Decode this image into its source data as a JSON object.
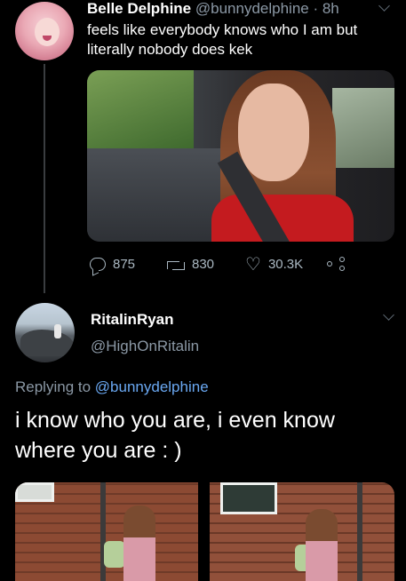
{
  "tweet1": {
    "name": "Belle Delphine",
    "handle_time": "@bunnydelphine · 8h",
    "text": "feels like everybody knows who I am but literally nobody does kek",
    "stats": {
      "replies": "875",
      "retweets": "830",
      "likes": "30.3K"
    },
    "icons": [
      "reply-icon",
      "retweet-icon",
      "like-icon",
      "share-icon",
      "chevron-down-icon"
    ]
  },
  "tweet2": {
    "name": "RitalinRyan",
    "handle": "@HighOnRitalin",
    "replying_prefix": "Replying to",
    "replying_mention": "@bunnydelphine",
    "text": "i know who you are, i even know where you are : )"
  },
  "colors": {
    "background": "#000000",
    "text": "#ffffff",
    "muted": "#8b98a5",
    "link": "#6aa8f2"
  }
}
